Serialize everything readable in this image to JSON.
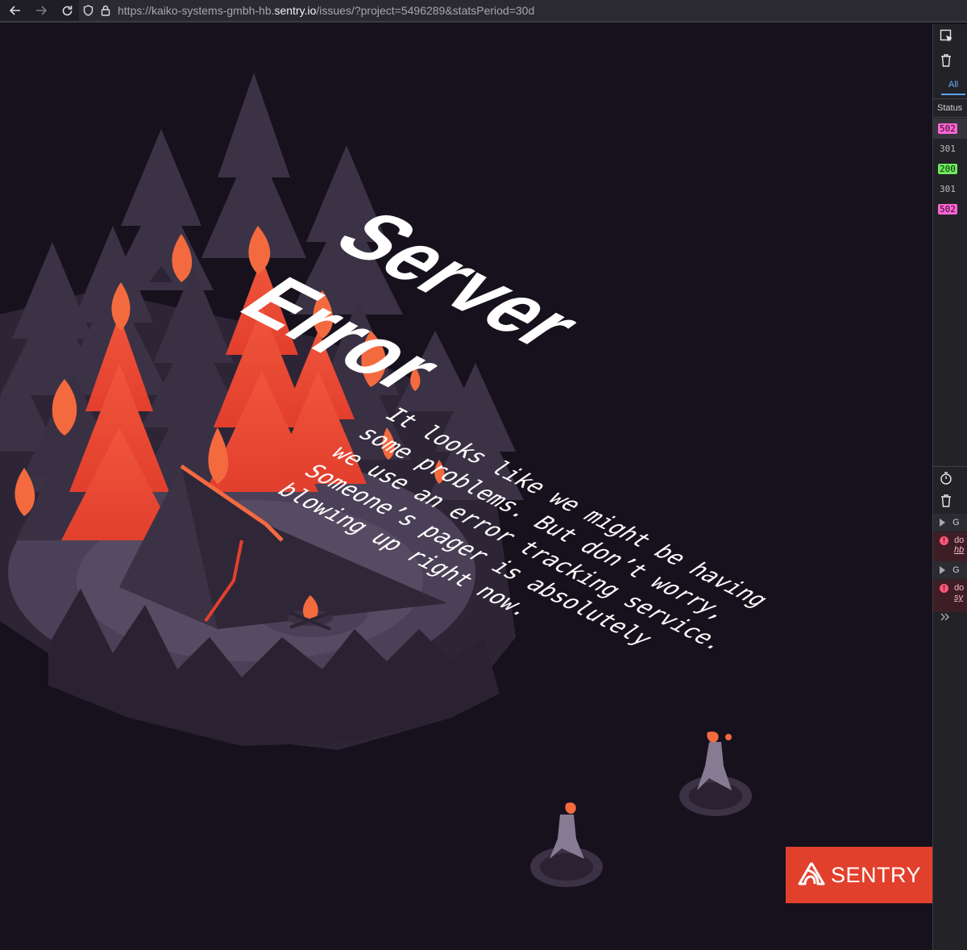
{
  "browser": {
    "url_prefix": "https://kaiko-systems-gmbh-hb.",
    "url_domain": "sentry.io",
    "url_suffix": "/issues/?project=5496289&statsPeriod=30d"
  },
  "page": {
    "title_line1": "Server",
    "title_line2": "Error",
    "message_lines": [
      "It looks like we might be having",
      "some problems. But don’t worry,",
      "we use an error tracking service.",
      "Someone’s pager is absolutely",
      "blowing up right now."
    ],
    "brand": "SENTRY",
    "colors": {
      "background": "#16111d",
      "flame": "#e1402d",
      "tree": "#3a3043",
      "clearing": "#4a4057"
    }
  },
  "devtools": {
    "tab_all": "All",
    "status_header": "Status",
    "status_rows": [
      "502",
      "301",
      "200",
      "301",
      "502"
    ],
    "console_rows": [
      {
        "type": "group",
        "text": "G"
      },
      {
        "type": "error",
        "text": "do",
        "sub": "hb"
      },
      {
        "type": "group",
        "text": "G"
      },
      {
        "type": "error",
        "text": "do",
        "sub": "sy"
      }
    ]
  }
}
